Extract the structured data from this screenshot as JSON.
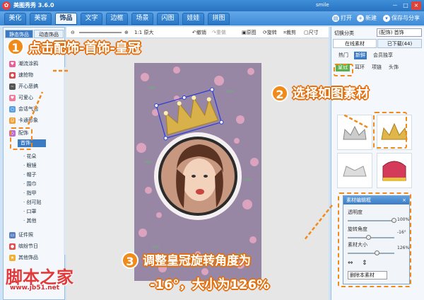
{
  "app": {
    "title": "美图秀秀 3.6.0",
    "user": "smile",
    "win_min": "－",
    "win_max": "□",
    "win_close": "×"
  },
  "menu": [
    "美化",
    "美容",
    "饰品",
    "文字",
    "边框",
    "场景",
    "闪图",
    "娃娃",
    "拼图"
  ],
  "top_actions": {
    "open": "打开",
    "new": "新建",
    "save": "保存与分享"
  },
  "left": {
    "tabs": [
      "静态饰品",
      "动态饰品"
    ],
    "items": [
      "潮流涂鸦",
      "速抢物",
      "开心恶搞",
      "可爱心",
      "会话气泡",
      "卡通形象"
    ],
    "group": "配饰",
    "group_selected": "首饰",
    "subitems": [
      "花朵",
      "眼镜",
      "帽子",
      "围巾",
      "指甲",
      "创可贴",
      "口罩",
      "其他"
    ],
    "bottom": [
      "证件照",
      "缤纷节日",
      "其他饰品"
    ]
  },
  "toolbar": {
    "zoom": "1:1 原大",
    "undo": "撤销",
    "redo": "重做",
    "original": "原图",
    "rotate": "旋转",
    "crop": "裁剪",
    "size": "尺寸"
  },
  "right": {
    "category_label": "切换分类",
    "category_value": "(配饰) 首饰",
    "tabs": [
      "在线素材",
      "已下载(44)"
    ],
    "subtabs": [
      "热门",
      "新鲜",
      "会员独享"
    ],
    "filters": [
      "皇冠",
      "耳环",
      "项链",
      "头饰"
    ]
  },
  "editor": {
    "title": "素材编辑框",
    "close": "×",
    "opacity_label": "透明度",
    "opacity_value": "100%",
    "opacity": 1.0,
    "rotation_label": "旋转角度",
    "rotation_value": "-16°",
    "rotation": -16,
    "size_label": "素材大小",
    "size_value": "126%",
    "size": 1.26,
    "delete": "删除本素材"
  },
  "steps": {
    "step1_num": "1",
    "step1_text": "点击配饰-首饰-皇冠",
    "step2_num": "2",
    "step2_text": "选择如图素材",
    "step3_num": "3",
    "step3_text_line1": "调整皇冠旋转角度为",
    "step3_text_line2": "-16°，大小为126%"
  },
  "watermark": {
    "text": "脚本之家",
    "url": "www.jb51.net"
  },
  "colors": {
    "accent": "#f08a1a",
    "brand_blue": "#2d78c6",
    "watermark": "#e23a3a"
  }
}
